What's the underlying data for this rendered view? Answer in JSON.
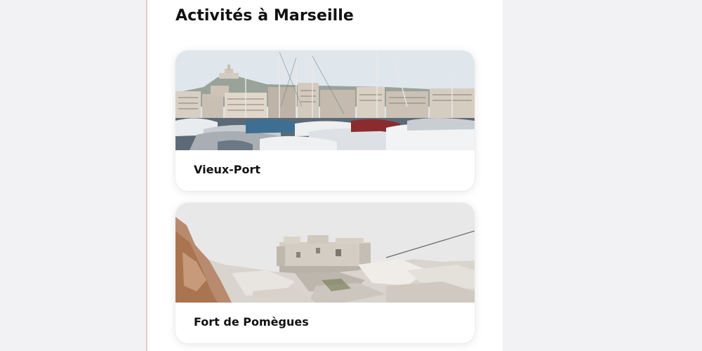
{
  "section": {
    "title": "Activités à Marseille"
  },
  "activities": [
    {
      "label": "Vieux-Port",
      "image_icon": "harbor-photo"
    },
    {
      "label": "Fort de Pomègues",
      "image_icon": "fort-photo"
    }
  ],
  "colors": {
    "background": "#f2f2f4",
    "panel": "#ffffff",
    "panel_border": "#e9c9cc",
    "text": "#111111"
  }
}
